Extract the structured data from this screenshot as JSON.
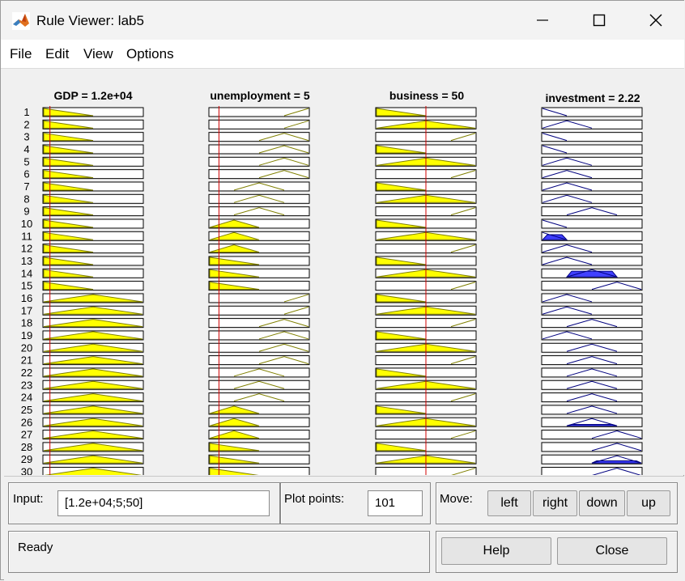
{
  "window": {
    "title": "Rule Viewer: lab5",
    "minimize_icon": "minimize-icon",
    "maximize_icon": "maximize-icon",
    "close_icon": "close-icon"
  },
  "menu": {
    "items": [
      "File",
      "Edit",
      "View",
      "Options"
    ]
  },
  "plot": {
    "columns": [
      {
        "title": "GDP = 1.2e+04",
        "indicator": 0.07
      },
      {
        "title": "unemployment = 5",
        "indicator": 0.1
      },
      {
        "title": "business = 50",
        "indicator": 0.5
      },
      {
        "title": "investment = 2.22",
        "indicator": null
      }
    ],
    "rule_numbers": [
      "1",
      "2",
      "3",
      "4",
      "5",
      "6",
      "7",
      "8",
      "9",
      "10",
      "11",
      "12",
      "13",
      "14",
      "15",
      "16",
      "17",
      "18",
      "19",
      "20",
      "21",
      "22",
      "23",
      "24",
      "25",
      "26",
      "27",
      "28",
      "29",
      "30"
    ],
    "input_shapes": [
      [
        "dl",
        "dl",
        "dl",
        "dl",
        "dl",
        "dl",
        "dl",
        "dl",
        "dl",
        "dl",
        "dl",
        "dl",
        "dl",
        "dl",
        "dl",
        "tw",
        "tw",
        "tw",
        "tw",
        "tw",
        "tw",
        "tw",
        "tw",
        "tw",
        "tw",
        "tw",
        "tw",
        "tw",
        "tw",
        "tw"
      ],
      [
        "ur",
        "ur",
        "mr",
        "mr",
        "mc",
        "mc",
        "lc",
        "lc",
        "lc",
        "ll",
        "ll",
        "ll",
        "dl",
        "dl",
        "dl",
        "ur",
        "ur",
        "mr",
        "mr",
        "mc",
        "mc",
        "lc",
        "lc",
        "lc",
        "ll",
        "ll",
        "ll",
        "dl",
        "dl",
        "dl"
      ],
      [
        "dl",
        "tr",
        "ur",
        "dl",
        "tr",
        "ur",
        "dl",
        "tr",
        "ur",
        "dl",
        "tr",
        "ur",
        "dl",
        "tr",
        "ur",
        "dl",
        "tr",
        "ur",
        "dl",
        "tr",
        "ur",
        "dl",
        "tr",
        "ur",
        "dl",
        "tr",
        "ur",
        "dl",
        "tr",
        "ur"
      ]
    ],
    "output_shapes": [
      {
        "shape": "a",
        "fill": 0
      },
      {
        "shape": "b",
        "fill": 0
      },
      {
        "shape": "a",
        "fill": 0
      },
      {
        "shape": "a",
        "fill": 0
      },
      {
        "shape": "b",
        "fill": 0
      },
      {
        "shape": "b",
        "fill": 0
      },
      {
        "shape": "b",
        "fill": 0
      },
      {
        "shape": "b",
        "fill": 0
      },
      {
        "shape": "c",
        "fill": 0
      },
      {
        "shape": "a",
        "fill": 0
      },
      {
        "shape": "a",
        "fill": 0.35
      },
      {
        "shape": "b",
        "fill": 0
      },
      {
        "shape": "b",
        "fill": 0
      },
      {
        "shape": "c",
        "fill": 0.4
      },
      {
        "shape": "d",
        "fill": 0
      },
      {
        "shape": "b",
        "fill": 0
      },
      {
        "shape": "b",
        "fill": 0
      },
      {
        "shape": "c",
        "fill": 0
      },
      {
        "shape": "b",
        "fill": 0
      },
      {
        "shape": "c",
        "fill": 0
      },
      {
        "shape": "c",
        "fill": 0
      },
      {
        "shape": "c",
        "fill": 0
      },
      {
        "shape": "c",
        "fill": 0
      },
      {
        "shape": "c",
        "fill": 0
      },
      {
        "shape": "c",
        "fill": 0
      },
      {
        "shape": "c",
        "fill": 0.1
      },
      {
        "shape": "d",
        "fill": 0
      },
      {
        "shape": "d",
        "fill": 0
      },
      {
        "shape": "d",
        "fill": 0.15
      },
      {
        "shape": "d",
        "fill": 0
      }
    ],
    "colors": {
      "input_fill": "#ffff00",
      "input_line": "#808000",
      "output_fill": "#4040ff",
      "output_line": "#00007f",
      "indicator": "#d00000"
    }
  },
  "controls": {
    "input_label": "Input:",
    "input_value": "[1.2e+04;5;50]",
    "plot_points_label": "Plot points:",
    "plot_points_value": "101",
    "move_label": "Move:",
    "move_buttons": [
      "left",
      "right",
      "down",
      "up"
    ],
    "status": "Ready",
    "help_label": "Help",
    "close_label": "Close"
  }
}
